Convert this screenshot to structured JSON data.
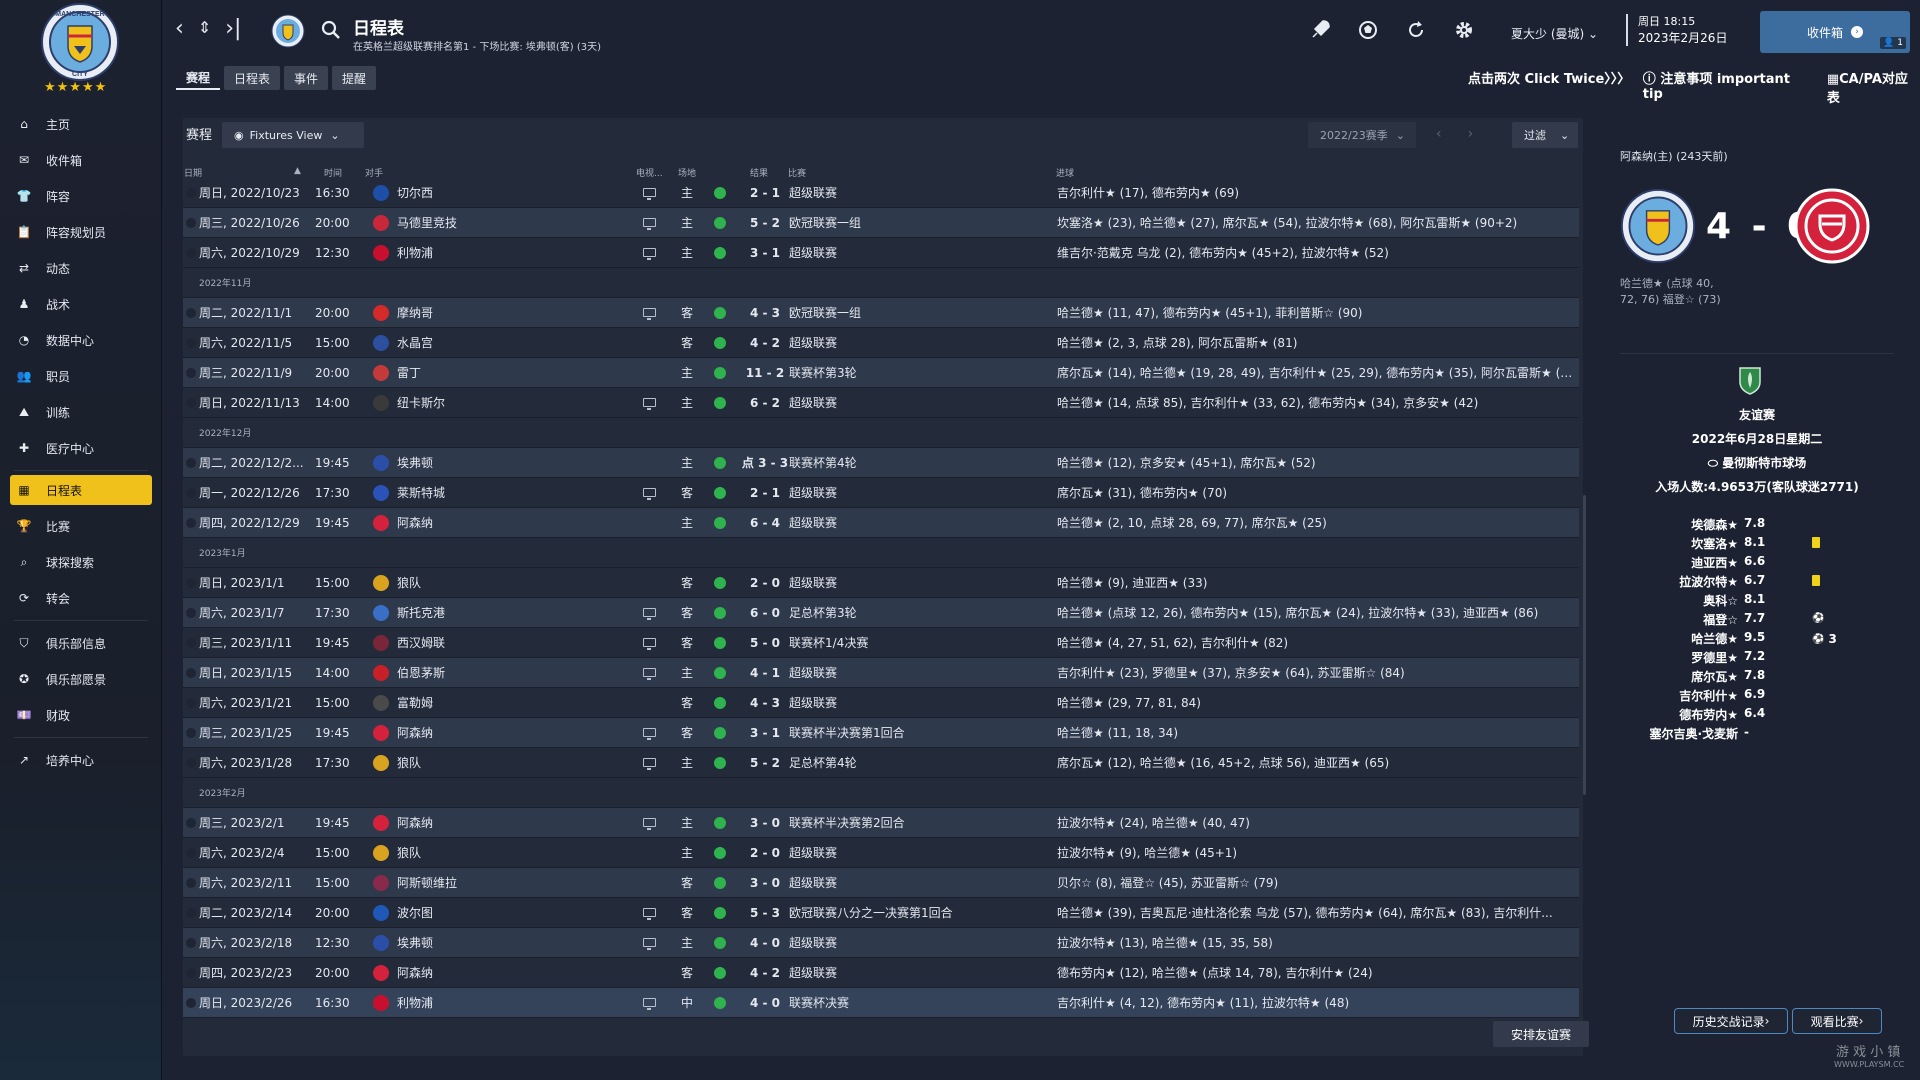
{
  "club": {
    "stars": "★★★★★",
    "crest_top": "MANCHESTER",
    "crest_bottom": "CITY"
  },
  "sidebar": {
    "items": [
      {
        "label": "主页",
        "icon": "home-icon"
      },
      {
        "label": "收件箱",
        "icon": "inbox-icon"
      },
      {
        "label": "阵容",
        "icon": "shirt-icon"
      },
      {
        "label": "阵容规划员",
        "icon": "clipboard-icon"
      },
      {
        "label": "动态",
        "icon": "dynamics-icon"
      },
      {
        "label": "战术",
        "icon": "tactics-icon"
      },
      {
        "label": "数据中心",
        "icon": "data-icon"
      },
      {
        "label": "职员",
        "icon": "staff-icon"
      },
      {
        "label": "训练",
        "icon": "training-icon"
      },
      {
        "label": "医疗中心",
        "icon": "medical-icon"
      },
      {
        "label": "日程表",
        "icon": "calendar-icon"
      },
      {
        "label": "比赛",
        "icon": "trophy-icon"
      },
      {
        "label": "球探搜索",
        "icon": "scout-search-icon"
      },
      {
        "label": "转会",
        "icon": "transfer-icon"
      },
      {
        "label": "俱乐部信息",
        "icon": "club-info-icon"
      },
      {
        "label": "俱乐部愿景",
        "icon": "club-vision-icon"
      },
      {
        "label": "财政",
        "icon": "finance-icon"
      },
      {
        "label": "培养中心",
        "icon": "development-icon"
      }
    ]
  },
  "header": {
    "title": "日程表",
    "subtitle": "在英格兰超级联赛排名第1 - 下场比赛: 埃弗顿(客) (3天)",
    "user": "夏大少 (曼城)",
    "time": "周日 18:15",
    "date": "2023年2月26日",
    "inbox_label": "收件箱",
    "inbox_badge": "1"
  },
  "tabs": [
    "赛程",
    "日程表",
    "事件",
    "提醒"
  ],
  "tips": {
    "click_twice": "点击两次 Click Twice〉〉〉",
    "notice": "注意事项 important tip",
    "ca_pa": "CA/PA对应表"
  },
  "fixtures": {
    "title": "赛程",
    "view_label": "Fixtures View",
    "season": "2022/23赛季",
    "filter_label": "过滤",
    "arrange_label": "安排友谊赛",
    "columns": {
      "date": "日期",
      "time": "时间",
      "opponent": "对手",
      "tv": "电视...",
      "venue": "场地",
      "result": "结果",
      "competition": "比赛",
      "scorers": "进球"
    },
    "groups": [
      {
        "month": "",
        "rows": [
          {
            "date": "周日, 2022/10/23",
            "time": "16:30",
            "opp": "切尔西",
            "crest": "#1e4fa8",
            "tv": true,
            "venue": "主",
            "score": "2 - 1",
            "comp": "超级联赛",
            "scorers": "吉尔利什★ (17), 德布劳内★ (69)"
          },
          {
            "date": "周三, 2022/10/26",
            "time": "20:00",
            "opp": "马德里竞技",
            "crest": "#c8283a",
            "tv": true,
            "venue": "主",
            "score": "5 - 2",
            "comp": "欧冠联赛一组",
            "scorers": "坎塞洛★ (23), 哈兰德★ (27), 席尔瓦★ (54), 拉波尔特★ (68), 阿尔瓦雷斯★ (90+2)"
          },
          {
            "date": "周六, 2022/10/29",
            "time": "12:30",
            "opp": "利物浦",
            "crest": "#c8102e",
            "tv": true,
            "venue": "主",
            "score": "3 - 1",
            "comp": "超级联赛",
            "scorers": "维吉尔·范戴克 乌龙 (2), 德布劳内★ (45+2), 拉波尔特★ (52)"
          }
        ]
      },
      {
        "month": "2022年11月",
        "rows": [
          {
            "date": "周二, 2022/11/1",
            "time": "20:00",
            "opp": "摩纳哥",
            "crest": "#d42a2a",
            "tv": true,
            "venue": "客",
            "score": "4 - 3",
            "comp": "欧冠联赛一组",
            "scorers": "哈兰德★ (11, 47), 德布劳内★ (45+1), 菲利普斯☆ (90)"
          },
          {
            "date": "周六, 2022/11/5",
            "time": "15:00",
            "opp": "水晶宫",
            "crest": "#2c4fa0",
            "tv": false,
            "venue": "客",
            "score": "4 - 2",
            "comp": "超级联赛",
            "scorers": "哈兰德★ (2, 3, 点球 28), 阿尔瓦雷斯★ (81)"
          },
          {
            "date": "周三, 2022/11/9",
            "time": "20:00",
            "opp": "雷丁",
            "crest": "#c43a3a",
            "tv": false,
            "venue": "主",
            "score": "11 - 2",
            "comp": "联赛杯第3轮",
            "scorers": "席尔瓦★ (14), 哈兰德★ (19, 28, 49), 吉尔利什★ (25, 29), 德布劳内★ (35), 阿尔瓦雷斯★ (76..."
          },
          {
            "date": "周日, 2022/11/13",
            "time": "14:00",
            "opp": "纽卡斯尔",
            "crest": "#3a3a3a",
            "tv": true,
            "venue": "主",
            "score": "6 - 2",
            "comp": "超级联赛",
            "scorers": "哈兰德★ (14, 点球 85), 吉尔利什★ (33, 62), 德布劳内★ (34), 京多安★ (42)"
          }
        ]
      },
      {
        "month": "2022年12月",
        "rows": [
          {
            "date": "周二, 2022/12/2...",
            "time": "19:45",
            "opp": "埃弗顿",
            "crest": "#2b4fa8",
            "tv": false,
            "venue": "主",
            "score": "点 3 - 3",
            "comp": "联赛杯第4轮",
            "scorers": "哈兰德★ (12), 京多安★ (45+1), 席尔瓦★ (52)"
          },
          {
            "date": "周一, 2022/12/26",
            "time": "17:30",
            "opp": "莱斯特城",
            "crest": "#2a52b8",
            "tv": true,
            "venue": "客",
            "score": "2 - 1",
            "comp": "超级联赛",
            "scorers": "席尔瓦★ (31), 德布劳内★ (70)"
          },
          {
            "date": "周四, 2022/12/29",
            "time": "19:45",
            "opp": "阿森纳",
            "crest": "#d4213c",
            "tv": false,
            "venue": "主",
            "score": "6 - 4",
            "comp": "超级联赛",
            "scorers": "哈兰德★ (2, 10, 点球 28, 69, 77), 席尔瓦★ (25)"
          }
        ]
      },
      {
        "month": "2023年1月",
        "rows": [
          {
            "date": "周日, 2023/1/1",
            "time": "15:00",
            "opp": "狼队",
            "crest": "#d9a320",
            "tv": false,
            "venue": "客",
            "score": "2 - 0",
            "comp": "超级联赛",
            "scorers": "哈兰德★ (9), 迪亚西★ (33)"
          },
          {
            "date": "周六, 2023/1/7",
            "time": "17:30",
            "opp": "斯托克港",
            "crest": "#3a6fc8",
            "tv": true,
            "venue": "客",
            "score": "6 - 0",
            "comp": "足总杯第3轮",
            "scorers": "哈兰德★ (点球 12, 26), 德布劳内★ (15), 席尔瓦★ (24), 拉波尔特★ (33), 迪亚西★ (86)"
          },
          {
            "date": "周三, 2023/1/11",
            "time": "19:45",
            "opp": "西汉姆联",
            "crest": "#7a2639",
            "tv": true,
            "venue": "客",
            "score": "5 - 0",
            "comp": "联赛杯1/4决赛",
            "scorers": "哈兰德★ (4, 27, 51, 62), 吉尔利什★ (82)"
          },
          {
            "date": "周日, 2023/1/15",
            "time": "14:00",
            "opp": "伯恩茅斯",
            "crest": "#c82028",
            "tv": true,
            "venue": "主",
            "score": "4 - 1",
            "comp": "超级联赛",
            "scorers": "吉尔利什★ (23), 罗德里★ (37), 京多安★ (64), 苏亚雷斯☆ (84)"
          },
          {
            "date": "周六, 2023/1/21",
            "time": "15:00",
            "opp": "富勒姆",
            "crest": "#4a4a4a",
            "tv": false,
            "venue": "客",
            "score": "4 - 3",
            "comp": "超级联赛",
            "scorers": "哈兰德★ (29, 77, 81, 84)"
          },
          {
            "date": "周三, 2023/1/25",
            "time": "19:45",
            "opp": "阿森纳",
            "crest": "#d4213c",
            "tv": true,
            "venue": "客",
            "score": "3 - 1",
            "comp": "联赛杯半决赛第1回合",
            "scorers": "哈兰德★ (11, 18, 34)"
          },
          {
            "date": "周六, 2023/1/28",
            "time": "17:30",
            "opp": "狼队",
            "crest": "#d9a320",
            "tv": true,
            "venue": "主",
            "score": "5 - 2",
            "comp": "足总杯第4轮",
            "scorers": "席尔瓦★ (12), 哈兰德★ (16, 45+2, 点球 56), 迪亚西★ (65)"
          }
        ]
      },
      {
        "month": "2023年2月",
        "rows": [
          {
            "date": "周三, 2023/2/1",
            "time": "19:45",
            "opp": "阿森纳",
            "crest": "#d4213c",
            "tv": true,
            "venue": "主",
            "score": "3 - 0",
            "comp": "联赛杯半决赛第2回合",
            "scorers": "拉波尔特★ (24), 哈兰德★ (40, 47)"
          },
          {
            "date": "周六, 2023/2/4",
            "time": "15:00",
            "opp": "狼队",
            "crest": "#d9a320",
            "tv": false,
            "venue": "主",
            "score": "2 - 0",
            "comp": "超级联赛",
            "scorers": "拉波尔特★ (9), 哈兰德★ (45+1)"
          },
          {
            "date": "周六, 2023/2/11",
            "time": "15:00",
            "opp": "阿斯顿维拉",
            "crest": "#8a2a4a",
            "tv": false,
            "venue": "客",
            "score": "3 - 0",
            "comp": "超级联赛",
            "scorers": "贝尔☆ (8), 福登☆ (45), 苏亚雷斯☆ (79)"
          },
          {
            "date": "周二, 2023/2/14",
            "time": "20:00",
            "opp": "波尔图",
            "crest": "#1f58b8",
            "tv": true,
            "venue": "客",
            "score": "5 - 3",
            "comp": "欧冠联赛八分之一决赛第1回合",
            "scorers": "哈兰德★ (39), 吉奥瓦尼·迪杜洛伦索 乌龙 (57), 德布劳内★ (64), 席尔瓦★ (83), 吉尔利什..."
          },
          {
            "date": "周六, 2023/2/18",
            "time": "12:30",
            "opp": "埃弗顿",
            "crest": "#2b4fa8",
            "tv": true,
            "venue": "主",
            "score": "4 - 0",
            "comp": "超级联赛",
            "scorers": "拉波尔特★ (13), 哈兰德★ (15, 35, 58)"
          },
          {
            "date": "周四, 2023/2/23",
            "time": "20:00",
            "opp": "阿森纳",
            "crest": "#d4213c",
            "tv": false,
            "venue": "客",
            "score": "4 - 2",
            "comp": "超级联赛",
            "scorers": "德布劳内★ (12), 哈兰德★ (点球 14, 78), 吉尔利什★ (24)"
          },
          {
            "date": "周日, 2023/2/26",
            "time": "16:30",
            "opp": "利物浦",
            "crest": "#c8102e",
            "tv": true,
            "venue": "中",
            "score": "4 - 0",
            "comp": "联赛杯决赛",
            "scorers": "吉尔利什★ (4, 12), 德布劳内★ (11), 拉波尔特★ (48)"
          }
        ]
      }
    ]
  },
  "match_panel": {
    "header": "阿森纳(主) (243天前)",
    "score": "4 - 0",
    "home_scorers": "哈兰德★ (点球 40, 72, 76) 福登☆ (73)",
    "competition": "友谊赛",
    "date": "2022年6月28日星期二",
    "stadium": "曼彻斯特市球场",
    "attendance": "入场人数:4.9653万(客队球迷2771)",
    "ratings": [
      {
        "name": "埃德森★",
        "rating": "7.8",
        "extra": ""
      },
      {
        "name": "坎塞洛★",
        "rating": "8.1",
        "extra": "yellow"
      },
      {
        "name": "迪亚西★",
        "rating": "6.6",
        "extra": ""
      },
      {
        "name": "拉波尔特★",
        "rating": "6.7",
        "extra": "yellow"
      },
      {
        "name": "奥科☆",
        "rating": "8.1",
        "extra": ""
      },
      {
        "name": "福登☆",
        "rating": "7.7",
        "extra": "ball"
      },
      {
        "name": "哈兰德★",
        "rating": "9.5",
        "extra": "ball3"
      },
      {
        "name": "罗德里★",
        "rating": "7.2",
        "extra": ""
      },
      {
        "name": "席尔瓦★",
        "rating": "7.8",
        "extra": ""
      },
      {
        "name": "吉尔利什★",
        "rating": "6.9",
        "extra": ""
      },
      {
        "name": "德布劳内★",
        "rating": "6.4",
        "extra": ""
      },
      {
        "name": "塞尔吉奥·戈麦斯",
        "rating": "-",
        "extra": ""
      }
    ],
    "ball_count": "3",
    "history_label": "历史交战记录",
    "watch_label": "观看比赛"
  },
  "watermark": {
    "text": "游 戏 小 镇",
    "url": "WWW.PLAYSM.CC"
  }
}
